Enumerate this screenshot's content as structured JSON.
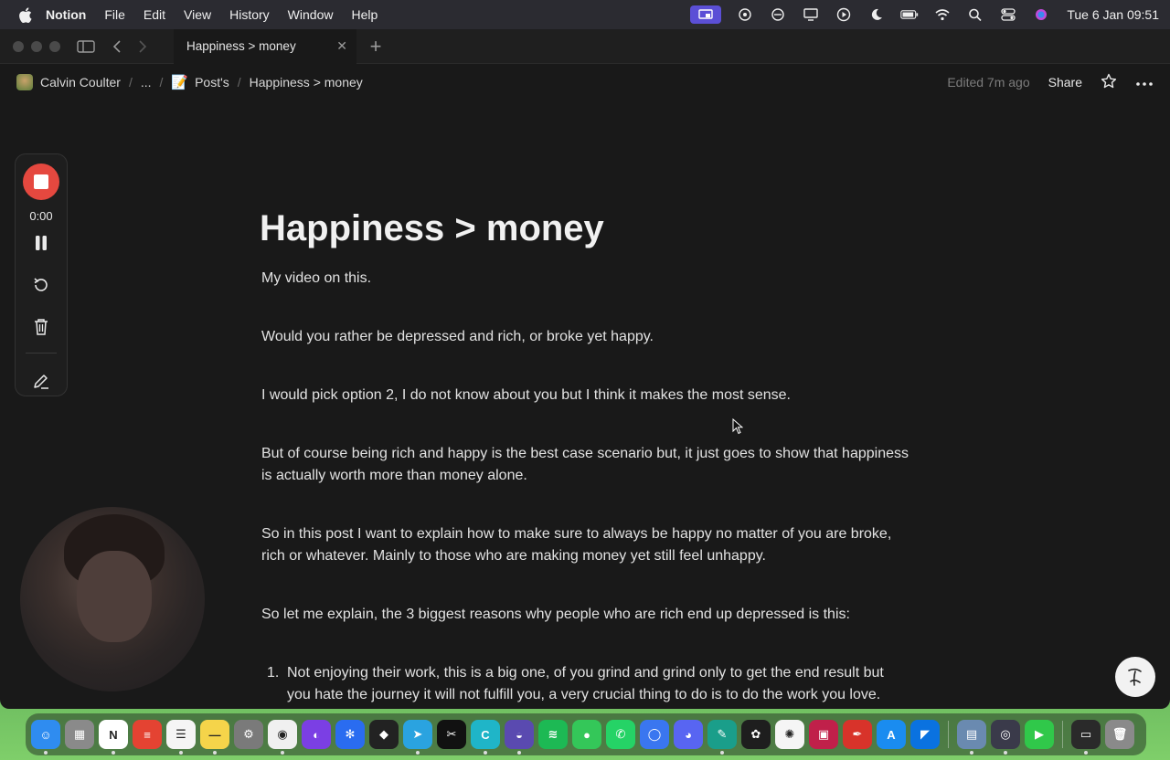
{
  "menubar": {
    "app_name": "Notion",
    "items": [
      "File",
      "Edit",
      "View",
      "History",
      "Window",
      "Help"
    ],
    "clock": "Tue 6 Jan  09:51"
  },
  "tab": {
    "title": "Happiness > money"
  },
  "breadcrumb": {
    "workspace": "Calvin Coulter",
    "ellipsis": "...",
    "parent_emoji": "📝",
    "parent": "Post's",
    "current": "Happiness > money"
  },
  "topbar": {
    "edited": "Edited 7m ago",
    "share_label": "Share"
  },
  "recorder": {
    "time": "0:00"
  },
  "document": {
    "title": "Happiness > money",
    "paragraphs": [
      "My video on this.",
      "Would you rather be depressed and rich, or broke yet happy.",
      "I would pick option 2, I do not know about you but I think it makes the most sense.",
      "But of course being rich and happy is the best case scenario but, it just goes to show that happiness is actually worth more than money alone.",
      "So in this post I want to explain how to make sure to always be happy no matter of you are broke, rich or whatever. Mainly to those who are making money yet still feel unhappy.",
      "So let me explain, the 3 biggest reasons why people who are rich end up depressed is this:"
    ],
    "list": [
      {
        "number": "1.",
        "text": "Not enjoying their work, this is a big one, of you grind and grind only to get the end result but you hate the journey it will not fulfill you, a very crucial thing to do is to do the work you love."
      }
    ]
  },
  "dock": {
    "apps": [
      {
        "name": "finder",
        "color": "#2f8cf0",
        "glyph": "☺"
      },
      {
        "name": "launchpad",
        "color": "#8a8a8a",
        "glyph": "▦"
      },
      {
        "name": "notion",
        "color": "#ffffff",
        "glyph": "N"
      },
      {
        "name": "todoist",
        "color": "#e44332",
        "glyph": "≡"
      },
      {
        "name": "reminders",
        "color": "#f5f5f5",
        "glyph": "☰"
      },
      {
        "name": "notes",
        "color": "#f5d44a",
        "glyph": "—"
      },
      {
        "name": "settings",
        "color": "#7a7a7a",
        "glyph": "⚙"
      },
      {
        "name": "chrome",
        "color": "#f0f0f0",
        "glyph": "◉"
      },
      {
        "name": "arc",
        "color": "#7b3fe4",
        "glyph": "◐"
      },
      {
        "name": "snowflake-app",
        "color": "#2a6cf0",
        "glyph": "✻"
      },
      {
        "name": "audio-app",
        "color": "#222222",
        "glyph": "◆"
      },
      {
        "name": "telegram",
        "color": "#2aa3e0",
        "glyph": "➤"
      },
      {
        "name": "capcut",
        "color": "#111111",
        "glyph": "✂"
      },
      {
        "name": "canva",
        "color": "#1fb5c8",
        "glyph": "C"
      },
      {
        "name": "vpn-app",
        "color": "#5a4ab0",
        "glyph": "◒"
      },
      {
        "name": "spotify",
        "color": "#1db954",
        "glyph": "≋"
      },
      {
        "name": "messages",
        "color": "#34c759",
        "glyph": "●"
      },
      {
        "name": "whatsapp",
        "color": "#25d366",
        "glyph": "✆"
      },
      {
        "name": "signal",
        "color": "#3a76f0",
        "glyph": "◯"
      },
      {
        "name": "discord",
        "color": "#5865f2",
        "glyph": "◕"
      },
      {
        "name": "feather-app",
        "color": "#1a9e8a",
        "glyph": "✎"
      },
      {
        "name": "chatgpt",
        "color": "#1e1e1e",
        "glyph": "✿"
      },
      {
        "name": "photos",
        "color": "#f5f5f5",
        "glyph": "✺"
      },
      {
        "name": "red-app",
        "color": "#c0204a",
        "glyph": "▣"
      },
      {
        "name": "quill-app",
        "color": "#d8332a",
        "glyph": "✒"
      },
      {
        "name": "app-store",
        "color": "#1a8cf0",
        "glyph": "A"
      },
      {
        "name": "blue-app",
        "color": "#0a72e0",
        "glyph": "◤"
      },
      {
        "name": "preview",
        "color": "#6a8ab0",
        "glyph": "▤"
      },
      {
        "name": "quicktime",
        "color": "#3a3a4a",
        "glyph": "◎"
      },
      {
        "name": "facetime",
        "color": "#30c84a",
        "glyph": "▶"
      },
      {
        "name": "screen-recorder",
        "color": "#2a2a2a",
        "glyph": "▭"
      },
      {
        "name": "trash",
        "color": "#8a8a8a",
        "glyph": "🗑"
      }
    ]
  }
}
